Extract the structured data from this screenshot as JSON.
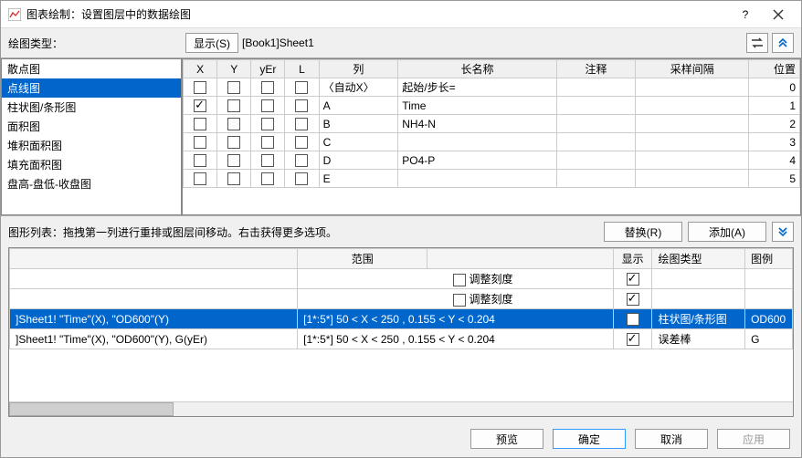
{
  "title": "图表绘制：设置图层中的数据绘图",
  "toolbar": {
    "plot_type_label": "绘图类型：",
    "show_btn": "显示(S)",
    "sheet_ref": "[Book1]Sheet1"
  },
  "plot_types": {
    "items": [
      "散点图",
      "点线图",
      "柱状图/条形图",
      "面积图",
      "堆积面积图",
      "填充面积图",
      "盘高-盘低-收盘图"
    ],
    "selected": 1
  },
  "data_cols": {
    "headers": {
      "x": "X",
      "y": "Y",
      "yer": "yEr",
      "l": "L",
      "col": "列",
      "ln": "长名称",
      "an": "注释",
      "si": "采样间隔",
      "pos": "位置"
    },
    "rows": [
      {
        "x": false,
        "y": false,
        "yer": false,
        "l": false,
        "col": "〈自动X〉",
        "ln": "起始/步长=",
        "an": "",
        "si": "",
        "pos": "0"
      },
      {
        "x": true,
        "y": false,
        "yer": false,
        "l": false,
        "col": "A",
        "ln": "Time",
        "an": "",
        "si": "",
        "pos": "1"
      },
      {
        "x": false,
        "y": false,
        "yer": false,
        "l": false,
        "col": "B",
        "ln": "NH4-N",
        "an": "",
        "si": "",
        "pos": "2"
      },
      {
        "x": false,
        "y": false,
        "yer": false,
        "l": false,
        "col": "C",
        "ln": "",
        "an": "",
        "si": "",
        "pos": "3"
      },
      {
        "x": false,
        "y": false,
        "yer": false,
        "l": false,
        "col": "D",
        "ln": "PO4-P",
        "an": "",
        "si": "",
        "pos": "4"
      },
      {
        "x": false,
        "y": false,
        "yer": false,
        "l": false,
        "col": "E",
        "ln": "",
        "an": "",
        "si": "",
        "pos": "5"
      }
    ]
  },
  "hint": "图形列表：拖拽第一列进行重排或图层间移动。右击获得更多选项。",
  "hint_buttons": {
    "replace": "替换(R)",
    "add": "添加(A)"
  },
  "layer_table": {
    "headers": {
      "blank": "",
      "range": "范围",
      "blank2": "",
      "show": "显示",
      "type": "绘图类型",
      "legend": "图例"
    },
    "rows": [
      {
        "sel": false,
        "c0": "",
        "range": "",
        "mid": "调整刻度",
        "show": true,
        "type": "",
        "legend": ""
      },
      {
        "sel": false,
        "c0": "",
        "range": "",
        "mid": "调整刻度",
        "show": true,
        "type": "",
        "legend": ""
      },
      {
        "sel": true,
        "c0": "]Sheet1! \"Time\"(X), \"OD600\"(Y)",
        "range": "[1*:5*]   50 < X < 250 , 0.155 < Y < 0.204",
        "mid": "",
        "show": true,
        "type": "柱状图/条形图",
        "legend": "OD600"
      },
      {
        "sel": false,
        "c0": "]Sheet1! \"Time\"(X), \"OD600\"(Y), G(yEr)",
        "range": "[1*:5*]   50 < X < 250 , 0.155 < Y < 0.204",
        "mid": "",
        "show": true,
        "type": "误差棒",
        "legend": "G"
      }
    ]
  },
  "footer": {
    "preview": "预览",
    "ok": "确定",
    "cancel": "取消",
    "apply": "应用"
  }
}
